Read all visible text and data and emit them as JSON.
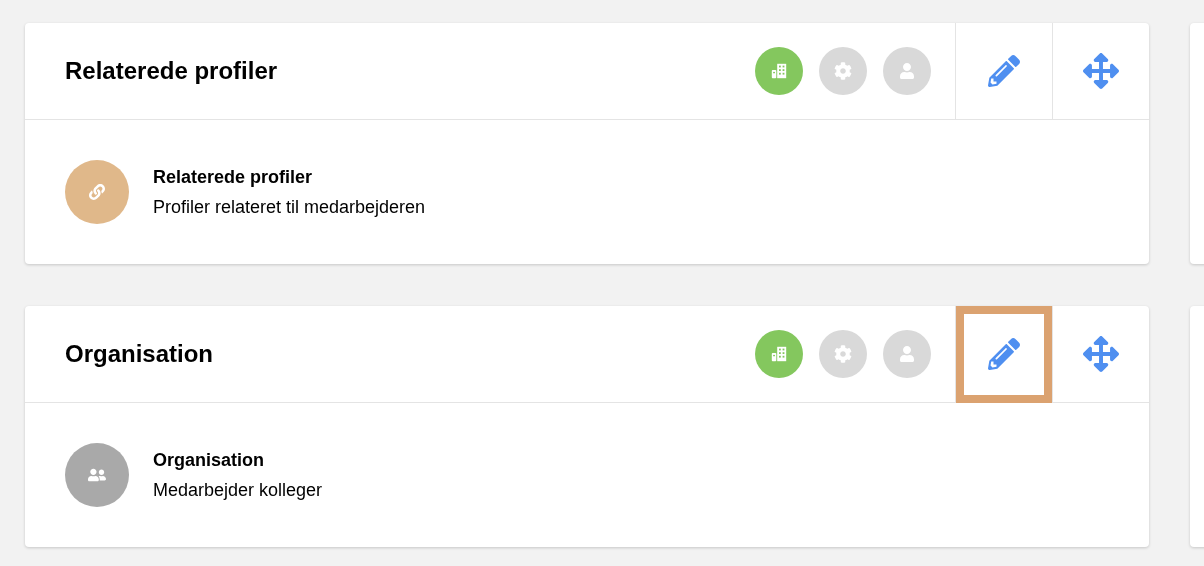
{
  "cards": [
    {
      "title": "Relaterede profiler",
      "toggles": [
        {
          "kind": "building",
          "active": true
        },
        {
          "kind": "gear",
          "active": false
        },
        {
          "kind": "person",
          "active": false
        }
      ],
      "edit": {
        "highlighted": false
      },
      "item": {
        "kind": "link",
        "color": "#e0b88a",
        "title": "Relaterede profiler",
        "subtitle": "Profiler relateret til medarbejderen"
      }
    },
    {
      "title": "Organisation",
      "toggles": [
        {
          "kind": "building",
          "active": true
        },
        {
          "kind": "gear",
          "active": false
        },
        {
          "kind": "person",
          "active": false
        }
      ],
      "edit": {
        "highlighted": true
      },
      "item": {
        "kind": "people",
        "color": "#a9a9a9",
        "title": "Organisation",
        "subtitle": "Medarbejder kolleger"
      }
    }
  ]
}
